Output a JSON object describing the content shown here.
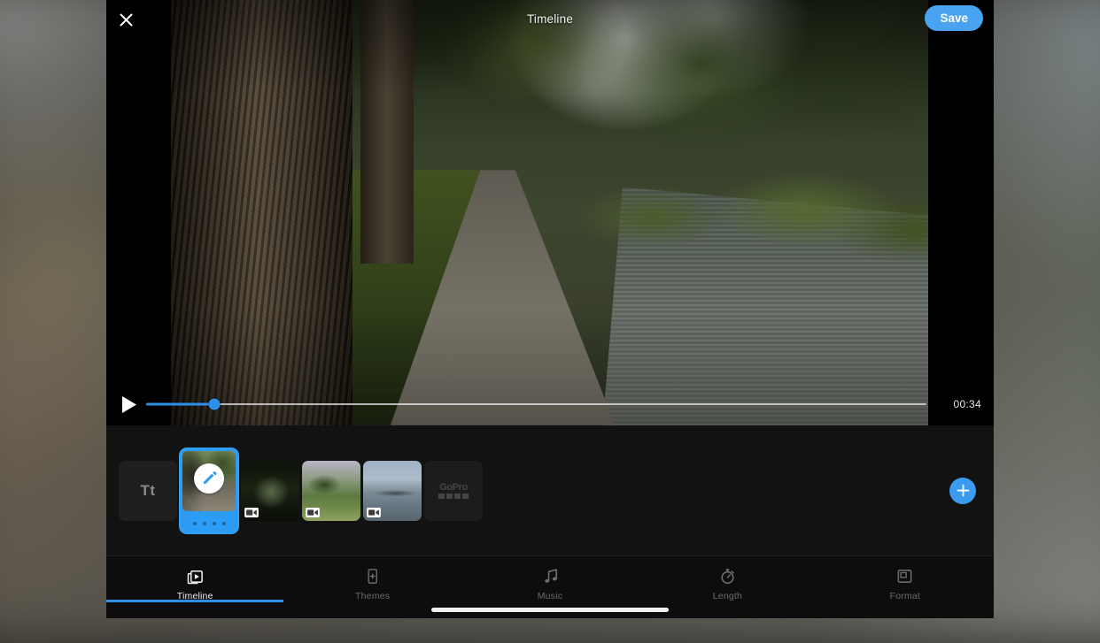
{
  "window": {
    "title": "Timeline",
    "close_icon": "close-x-icon",
    "save_label": "Save",
    "accent_color": "#2d8fe8",
    "save_button_color": "#4aa3f0",
    "panel_background": "#0b0b0b"
  },
  "player": {
    "play_icon": "play-triangle-icon",
    "time_label": "00:34",
    "progress_percent": 8.7,
    "scrubber_thumb_color": "#2d8fe8",
    "scrubber_track_color": "#ebebeb"
  },
  "timeline_strip": {
    "add_icon": "plus-icon",
    "add_button_color": "#3a9bf0",
    "clips": [
      {
        "name": "title-card-clip",
        "kind": "title",
        "label": "Tt",
        "selected": false
      },
      {
        "name": "video-clip-1",
        "kind": "video",
        "label": "",
        "selected": true,
        "edit_icon": "pencil-edit-icon",
        "handle_dots": 4,
        "badge_icon": "video-camera-icon"
      },
      {
        "name": "video-clip-2",
        "kind": "video",
        "label": "",
        "selected": false,
        "badge_icon": "video-camera-icon"
      },
      {
        "name": "video-clip-3",
        "kind": "video",
        "label": "",
        "selected": false,
        "badge_icon": "video-camera-icon"
      },
      {
        "name": "video-clip-4",
        "kind": "video",
        "label": "",
        "selected": false,
        "badge_icon": "video-camera-icon"
      },
      {
        "name": "gopro-outro-clip",
        "kind": "outro",
        "label": "GoPro",
        "selected": false
      }
    ]
  },
  "tabbar": {
    "active_index": 0,
    "tabs": [
      {
        "label": "Timeline",
        "icon": "timeline-clips-icon"
      },
      {
        "label": "Themes",
        "icon": "theme-sparkle-icon"
      },
      {
        "label": "Music",
        "icon": "music-note-icon"
      },
      {
        "label": "Length",
        "icon": "stopwatch-icon"
      },
      {
        "label": "Format",
        "icon": "aspect-ratio-icon"
      }
    ]
  }
}
